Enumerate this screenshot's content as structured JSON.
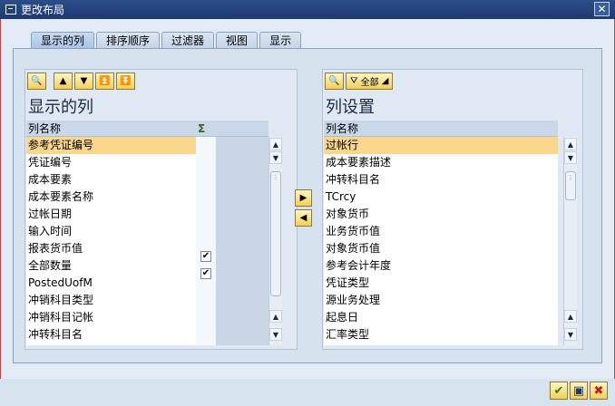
{
  "window": {
    "title": "更改布局",
    "close_glyph": "✕"
  },
  "tabs": [
    {
      "label": "显示的列",
      "active": true
    },
    {
      "label": "排序顺序",
      "active": false
    },
    {
      "label": "过滤器",
      "active": false
    },
    {
      "label": "视图",
      "active": false
    },
    {
      "label": "显示",
      "active": false
    }
  ],
  "left_panel": {
    "title": "显示的列",
    "column_header": "列名称",
    "sum_icon": "Σ",
    "rows": [
      {
        "label": "参考凭证编号",
        "selected": true,
        "checked": false
      },
      {
        "label": "凭证编号",
        "selected": false,
        "checked": false
      },
      {
        "label": "成本要素",
        "selected": false,
        "checked": false
      },
      {
        "label": "成本要素名称",
        "selected": false,
        "checked": false
      },
      {
        "label": "过帐日期",
        "selected": false,
        "checked": false
      },
      {
        "label": "输入时间",
        "selected": false,
        "checked": false
      },
      {
        "label": "报表货币值",
        "selected": false,
        "checked": true
      },
      {
        "label": "全部数量",
        "selected": false,
        "checked": true
      },
      {
        "label": "PostedUofM",
        "selected": false,
        "checked": false
      },
      {
        "label": "冲销科目类型",
        "selected": false,
        "checked": false
      },
      {
        "label": "冲销科目记帐",
        "selected": false,
        "checked": false
      },
      {
        "label": "冲转科目名",
        "selected": false,
        "checked": false
      }
    ]
  },
  "right_panel": {
    "title": "列设置",
    "column_header": "列名称",
    "filter_label": "全部",
    "rows": [
      {
        "label": "过帐行",
        "selected": true
      },
      {
        "label": "成本要素描述",
        "selected": false
      },
      {
        "label": "冲转科目名",
        "selected": false
      },
      {
        "label": "TCrcy",
        "selected": false
      },
      {
        "label": "对象货币",
        "selected": false
      },
      {
        "label": "业务货币值",
        "selected": false
      },
      {
        "label": "对象货币值",
        "selected": false
      },
      {
        "label": "参考会计年度",
        "selected": false
      },
      {
        "label": "凭证类型",
        "selected": false
      },
      {
        "label": "源业务处理",
        "selected": false
      },
      {
        "label": "起息日",
        "selected": false
      },
      {
        "label": "汇率类型",
        "selected": false
      }
    ]
  },
  "colors": {
    "selected_row": "#fbd78e",
    "accent": "#1d3a70",
    "button_yellow": "#f2cf55"
  }
}
